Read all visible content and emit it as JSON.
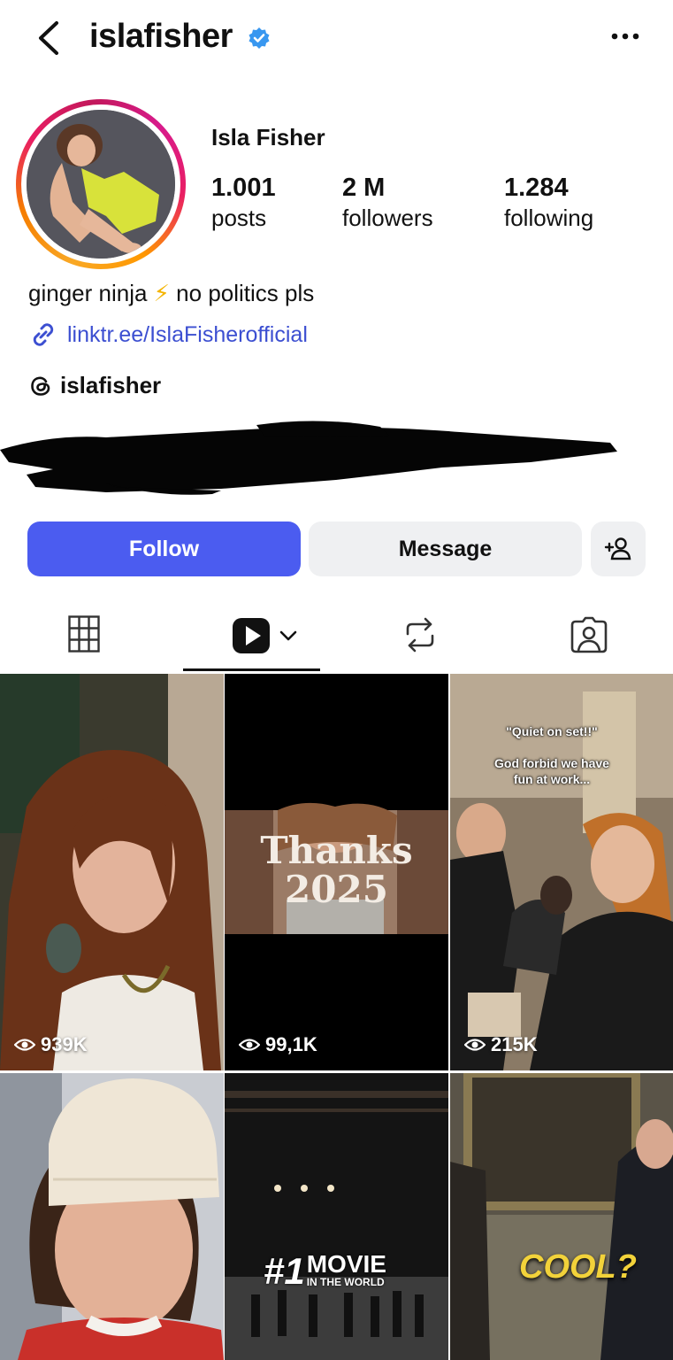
{
  "header": {
    "username": "islafisher"
  },
  "profile": {
    "display_name": "Isla Fisher",
    "stats": [
      {
        "value": "1.001",
        "label": "posts"
      },
      {
        "value": "2 M",
        "label": "followers"
      },
      {
        "value": "1.284",
        "label": "following"
      }
    ],
    "bio_part1": "ginger ninja",
    "bio_bolt": "⚡",
    "bio_part2": "no politics pls",
    "link": "linktr.ee/IslaFisherofficial",
    "threads_handle": "islafisher"
  },
  "actions": {
    "follow_label": "Follow",
    "message_label": "Message"
  },
  "colors": {
    "follow_blue": "#4b5cf0",
    "link_blue": "#3c4fd1",
    "verified_blue": "#3897f0"
  },
  "grid": {
    "items": [
      {
        "views": "939K"
      },
      {
        "views": "99,1K",
        "overlay_line1": "Thanks",
        "overlay_line2": "2025"
      },
      {
        "views": "215K",
        "caption_line1": "\"Quiet on set!!\"",
        "caption_line2": "God forbid we have",
        "caption_line3": "fun at work..."
      },
      {},
      {
        "overlay_big": "#1",
        "overlay_word": "MOVIE",
        "overlay_small": "IN THE WORLD"
      },
      {
        "overlay_text": "COOL?"
      }
    ]
  }
}
